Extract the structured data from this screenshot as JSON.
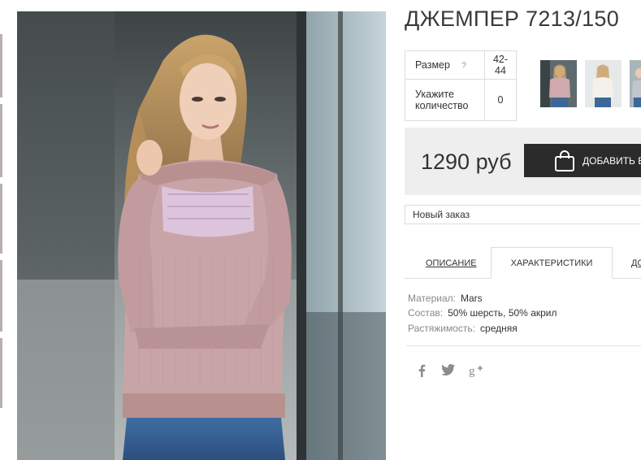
{
  "product": {
    "title": "ДЖЕМПЕР 7213/150"
  },
  "options": {
    "size_label": "Размер",
    "size_help": "?",
    "size_value": "42-44",
    "quantity_label": "Укажите количество",
    "quantity_value": "0"
  },
  "purchase": {
    "price": "1290 руб",
    "add_button_label": "ДОБАВИТЬ В",
    "order_select_value": "Новый заказ"
  },
  "tabs": {
    "description": "ОПИСАНИЕ",
    "characteristics": "ХАРАКТЕРИСТИКИ",
    "more": "ДО"
  },
  "characteristics": [
    {
      "key": "Материал:",
      "value": "Mars"
    },
    {
      "key": "Состав:",
      "value": "50% шерсть, 50% акрил"
    },
    {
      "key": "Растяжимость:",
      "value": "средняя"
    }
  ],
  "social": [
    "facebook-icon",
    "twitter-icon",
    "google-plus-icon"
  ],
  "colors": {
    "button_bg": "#2b2b2b",
    "buy_box_bg": "#eeeeee",
    "sweater": "#c9a4a6"
  }
}
